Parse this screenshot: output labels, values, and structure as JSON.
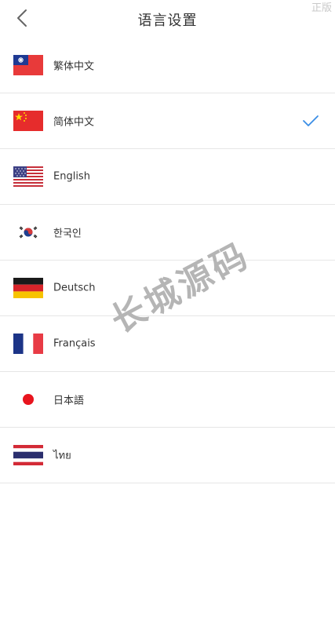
{
  "header": {
    "title": "语言设置",
    "corner_mark": "正版"
  },
  "languages": [
    {
      "label": "繁体中文",
      "flag": "taiwan-flag",
      "selected": false
    },
    {
      "label": "简体中文",
      "flag": "china-flag",
      "selected": true
    },
    {
      "label": "English",
      "flag": "usa-flag",
      "selected": false
    },
    {
      "label": "한국인",
      "flag": "korea-flag",
      "selected": false
    },
    {
      "label": "Deutsch",
      "flag": "germany-flag",
      "selected": false
    },
    {
      "label": "Français",
      "flag": "france-flag",
      "selected": false
    },
    {
      "label": "日本語",
      "flag": "japan-flag",
      "selected": false
    },
    {
      "label": "ไทย",
      "flag": "thailand-flag",
      "selected": false
    }
  ],
  "watermark": "长城源码",
  "colors": {
    "check": "#3a8ee6",
    "divider": "#e6e6e6",
    "text": "#333333"
  }
}
